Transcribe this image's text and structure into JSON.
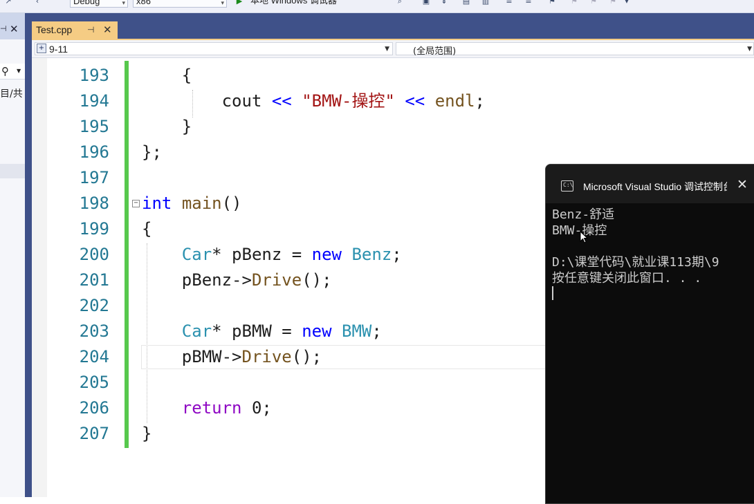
{
  "toolbar": {
    "configuration": "Debug",
    "platform": "x86",
    "run_label": "本地 Windows 调试器"
  },
  "document_tab": {
    "filename": "Test.cpp",
    "pin_glyph": "⊣",
    "close_glyph": "✕"
  },
  "navigation": {
    "scope_left": "9-11",
    "scope_right": "(全局范围)"
  },
  "left_panel": {
    "partial_text": "目/共"
  },
  "editor": {
    "line_numbers": [
      "193",
      "194",
      "195",
      "196",
      "197",
      "198",
      "199",
      "200",
      "201",
      "202",
      "203",
      "204",
      "205",
      "206",
      "207"
    ]
  },
  "console": {
    "title": "Microsoft Visual Studio 调试控制台",
    "close_glyph": "✕",
    "lines": [
      "Benz-舒适",
      "BMW-操控",
      "",
      "D:\\课堂代码\\就业课113期\\9",
      "按任意键关闭此窗口. . ."
    ]
  },
  "colors": {
    "tab_active": "#f5cc84",
    "chrome_blue": "#3f5189",
    "keyword": "#0000ff",
    "type": "#2b91af",
    "string": "#a31515",
    "line_number": "#237893",
    "change_bar": "#57c84d"
  }
}
